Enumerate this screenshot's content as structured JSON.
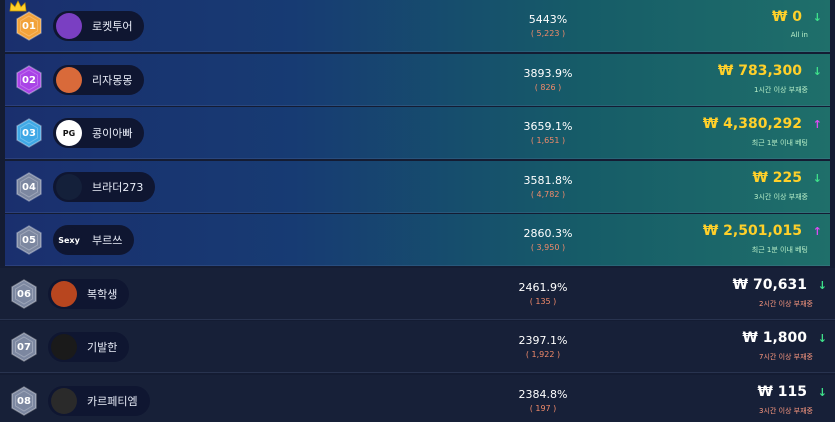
{
  "rows": [
    {
      "rank": "01",
      "name": "로켓투어",
      "percent": "5443%",
      "count": "( 5,223 )",
      "amount": "₩ 0",
      "status": "All in",
      "trend": "down",
      "hex_color": "#f2a23a",
      "avatar_text": "",
      "avatar_bg": "#7a3fc2",
      "highlight": true,
      "crown": true
    },
    {
      "rank": "02",
      "name": "리자몽몽",
      "percent": "3893.9%",
      "count": "( 826 )",
      "amount": "₩ 783,300",
      "status": "1시간 이상 부재중",
      "trend": "down",
      "hex_color": "#a943e6",
      "avatar_text": "",
      "avatar_bg": "#d96a3a",
      "highlight": true,
      "crown": false
    },
    {
      "rank": "03",
      "name": "콩이아빠",
      "percent": "3659.1%",
      "count": "( 1,651 )",
      "amount": "₩ 4,380,292",
      "status": "최근 1분 이내 베팅",
      "trend": "up",
      "hex_color": "#3fa8e6",
      "avatar_text": "PG",
      "avatar_bg": "#ffffff",
      "highlight": true,
      "crown": false
    },
    {
      "rank": "04",
      "name": "브라더273",
      "percent": "3581.8%",
      "count": "( 4,782 )",
      "amount": "₩ 225",
      "status": "3시간 이상 부재중",
      "trend": "down",
      "hex_color": "#7c87a0",
      "avatar_text": "",
      "avatar_bg": "#14203a",
      "highlight": true,
      "crown": false
    },
    {
      "rank": "05",
      "name": "부르쓰",
      "percent": "2860.3%",
      "count": "( 3,950 )",
      "amount": "₩ 2,501,015",
      "status": "최근 1분 이내 베팅",
      "trend": "up",
      "hex_color": "#7c87a0",
      "avatar_text": "Sexy",
      "avatar_bg": "#0f1631",
      "highlight": true,
      "crown": false
    },
    {
      "rank": "06",
      "name": "복학생",
      "percent": "2461.9%",
      "count": "( 135 )",
      "amount": "₩ 70,631",
      "status": "2시간 이상 부재중",
      "trend": "down",
      "hex_color": "#7c87a0",
      "avatar_text": "",
      "avatar_bg": "#b8461f",
      "highlight": false,
      "crown": false
    },
    {
      "rank": "07",
      "name": "기발한",
      "percent": "2397.1%",
      "count": "( 1,922 )",
      "amount": "₩ 1,800",
      "status": "7시간 이상 부재중",
      "trend": "down",
      "hex_color": "#7c87a0",
      "avatar_text": "",
      "avatar_bg": "#1a1a1a",
      "highlight": false,
      "crown": false
    },
    {
      "rank": "08",
      "name": "카르페티엠",
      "percent": "2384.8%",
      "count": "( 197 )",
      "amount": "₩ 115",
      "status": "3시간 이상 부재중",
      "trend": "down",
      "hex_color": "#7c87a0",
      "avatar_text": "",
      "avatar_bg": "#2a2a2a",
      "highlight": false,
      "crown": false
    }
  ],
  "icons": {
    "trend_down": "↓",
    "trend_up": "↑"
  }
}
